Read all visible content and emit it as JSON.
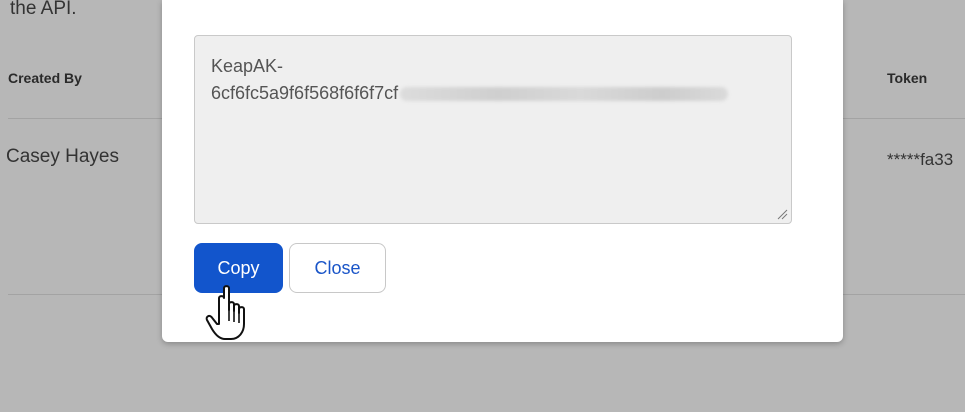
{
  "background": {
    "intro_text": "the API.",
    "columns": {
      "created_by": "Created By",
      "token": "Token"
    },
    "row": {
      "created_by": "Casey Hayes",
      "token": "*****fa33"
    }
  },
  "modal": {
    "key_prefix": "KeapAK-",
    "key_visible": "6cf6fc5a9f6f568f6f6f7cf",
    "copy_label": "Copy",
    "close_label": "Close"
  },
  "colors": {
    "primary": "#1255cc",
    "overlay": "#b7b7b7"
  },
  "icons": {
    "cursor": "hand-pointer-icon",
    "resize": "resize-grip-icon"
  }
}
